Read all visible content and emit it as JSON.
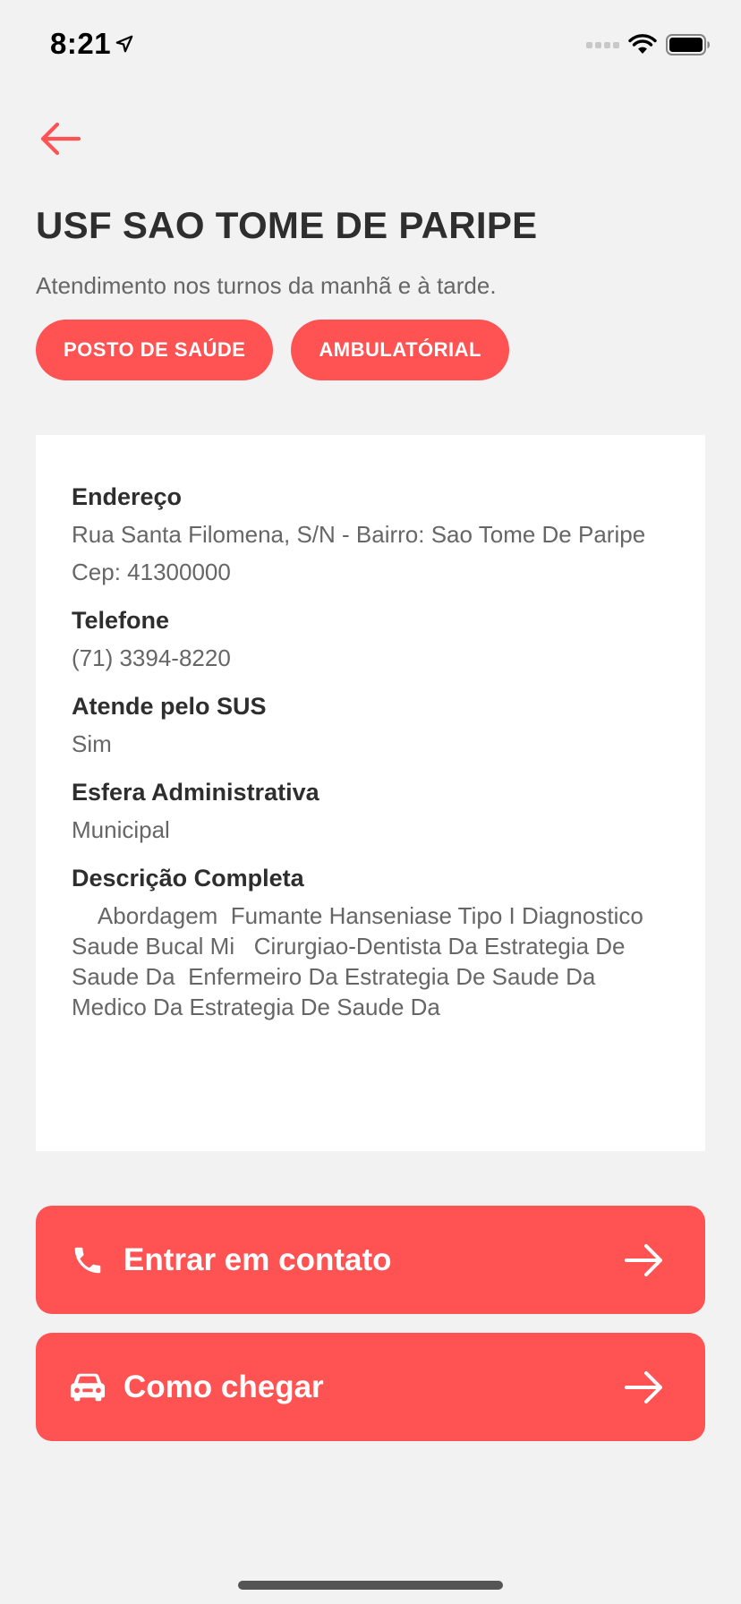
{
  "status_bar": {
    "time": "8:21",
    "icons": [
      "location-arrow-icon",
      "signal-icon",
      "wifi-icon",
      "battery-icon"
    ]
  },
  "header": {
    "back_icon": "arrow-left-icon",
    "title": "USF SAO TOME DE PARIPE",
    "subtitle": "Atendimento nos turnos da manhã e à tarde."
  },
  "tags": [
    "POSTO DE SAÚDE",
    "AMBULATÓRIAL"
  ],
  "details": {
    "address_label": "Endereço",
    "address_line": "Rua Santa Filomena, S/N - Bairro: Sao Tome De Paripe",
    "cep": "Cep: 41300000",
    "phone_label": "Telefone",
    "phone": "(71) 3394-8220",
    "sus_label": "Atende pelo SUS",
    "sus": "Sim",
    "sphere_label": "Esfera Administrativa",
    "sphere": "Municipal",
    "description_label": "Descrição Completa",
    "description": "    Abordagem  Fumante Hanseniase Tipo I Diagnostico  Saude Bucal Mi   Cirurgiao-Dentista Da Estrategia De Saude Da  Enfermeiro Da Estrategia De Saude Da  Medico Da Estrategia De Saude Da"
  },
  "actions": {
    "contact_label": "Entrar em contato",
    "contact_icon": "phone-icon",
    "directions_label": "Como chegar",
    "directions_icon": "car-icon",
    "arrow_icon": "arrow-right-icon"
  },
  "colors": {
    "accent": "#ff5252",
    "background": "#f2f2f2",
    "card": "#ffffff",
    "title_text": "#2e2e2e",
    "body_text": "#666666"
  }
}
